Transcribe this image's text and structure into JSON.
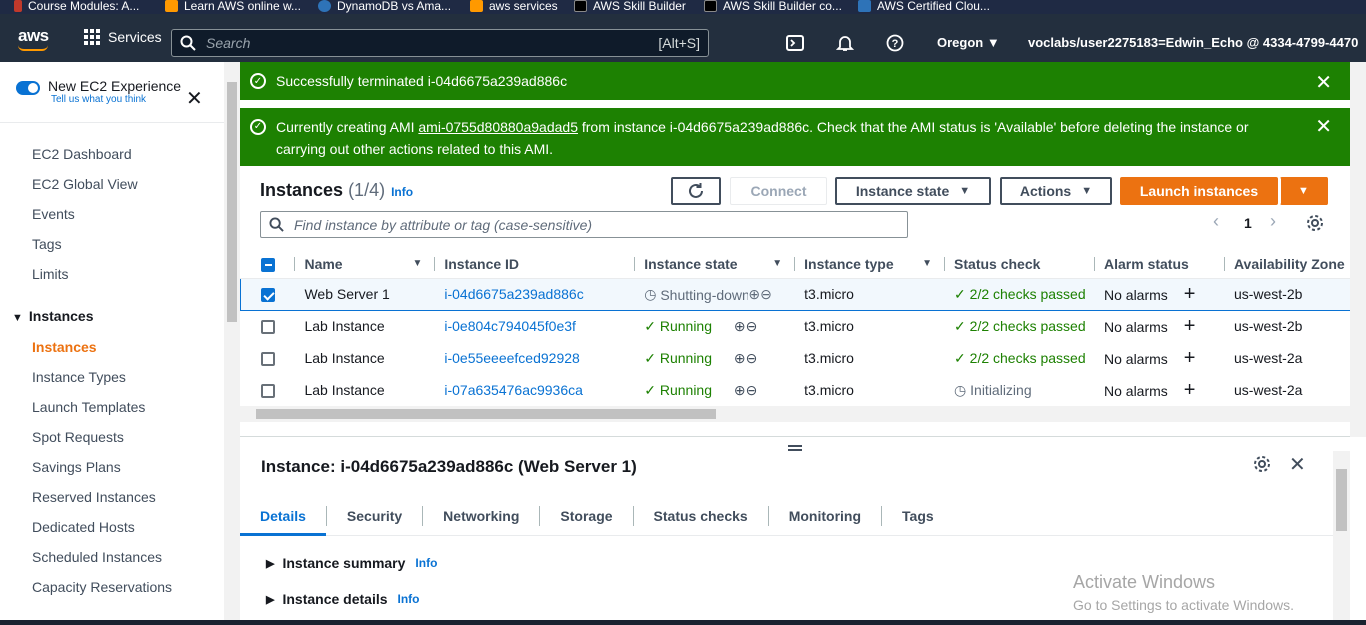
{
  "bookmarks": [
    {
      "label": "Course Modules: A...",
      "color": "#c0392b"
    },
    {
      "label": "Learn AWS online w...",
      "color": "#ff9900"
    },
    {
      "label": "DynamoDB vs Ama...",
      "color": "#2e73b8"
    },
    {
      "label": "aws services",
      "color": "#ff9900"
    },
    {
      "label": "AWS Skill Builder",
      "color": "#000000"
    },
    {
      "label": "AWS Skill Builder co...",
      "color": "#000000"
    },
    {
      "label": "AWS Certified Clou...",
      "color": "#2e73b8"
    }
  ],
  "topnav": {
    "logo": "aws",
    "services": "Services",
    "search_placeholder": "Search",
    "search_shortcut": "[Alt+S]",
    "region": "Oregon",
    "account": "voclabs/user2275183=Edwin_Echo @ 4334-4799-4470"
  },
  "sidebar": {
    "new_experience": "New EC2 Experience",
    "tell_us": "Tell us what you think",
    "items": [
      "EC2 Dashboard",
      "EC2 Global View",
      "Events",
      "Tags",
      "Limits"
    ],
    "section": "Instances",
    "sub_items": [
      "Instances",
      "Instance Types",
      "Launch Templates",
      "Spot Requests",
      "Savings Plans",
      "Reserved Instances",
      "Dedicated Hosts",
      "Scheduled Instances",
      "Capacity Reservations"
    ]
  },
  "flash": {
    "terminated": "Successfully terminated i-04d6675a239ad886c",
    "ami_prefix": "Currently creating AMI ",
    "ami_link": "ami-0755d80880a9adad5",
    "ami_suffix": " from instance i-04d6675a239ad886c. Check that the AMI status is 'Available' before deleting the instance or",
    "ami_line2": "carrying out other actions related to this AMI."
  },
  "instances": {
    "title": "Instances",
    "count": "(1/4)",
    "info": "Info",
    "connect": "Connect",
    "instance_state": "Instance state",
    "actions": "Actions",
    "launch": "Launch instances",
    "filter_placeholder": "Find instance by attribute or tag (case-sensitive)",
    "page": "1",
    "columns": [
      "Name",
      "Instance ID",
      "Instance state",
      "Instance type",
      "Status check",
      "Alarm status",
      "Availability Zone"
    ],
    "rows": [
      {
        "name": "Web Server 1",
        "id": "i-04d6675a239ad886c",
        "state": "Shutting-down",
        "type": "t3.micro",
        "check": "2/2 checks passed",
        "alarm": "No alarms",
        "az": "us-west-2b"
      },
      {
        "name": "Lab Instance",
        "id": "i-0e804c794045f0e3f",
        "state": "Running",
        "type": "t3.micro",
        "check": "2/2 checks passed",
        "alarm": "No alarms",
        "az": "us-west-2b"
      },
      {
        "name": "Lab Instance",
        "id": "i-0e55eeeefced92928",
        "state": "Running",
        "type": "t3.micro",
        "check": "2/2 checks passed",
        "alarm": "No alarms",
        "az": "us-west-2a"
      },
      {
        "name": "Lab Instance",
        "id": "i-07a635476ac9936ca",
        "state": "Running",
        "type": "t3.micro",
        "check": "Initializing",
        "alarm": "No alarms",
        "az": "us-west-2a"
      }
    ]
  },
  "detail": {
    "title": "Instance: i-04d6675a239ad886c (Web Server 1)",
    "tabs": [
      "Details",
      "Security",
      "Networking",
      "Storage",
      "Status checks",
      "Monitoring",
      "Tags"
    ],
    "summary": "Instance summary",
    "details": "Instance details",
    "info": "Info"
  },
  "watermark": {
    "line1": "Activate Windows",
    "line2": "Go to Settings to activate Windows."
  }
}
